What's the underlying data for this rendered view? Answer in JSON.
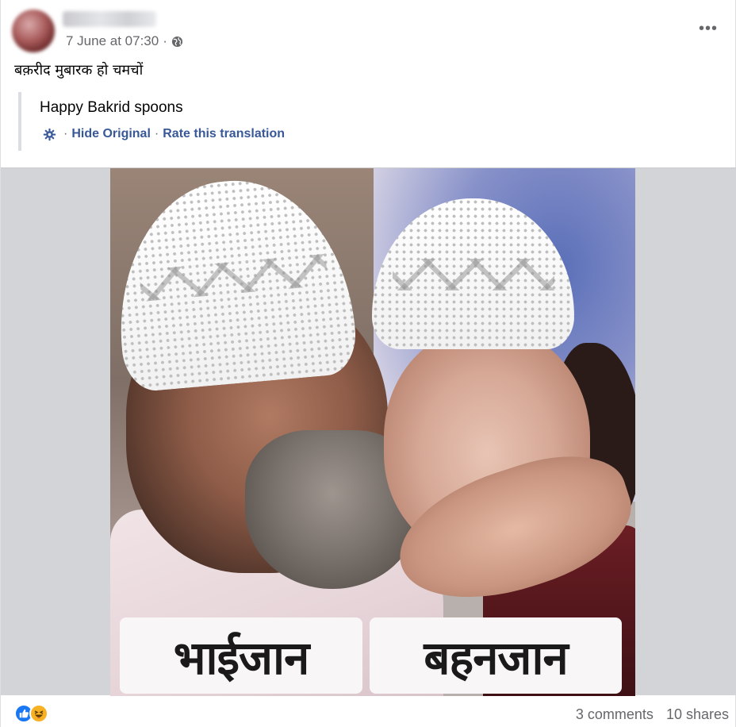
{
  "post": {
    "timestamp": "7 June at 07:30",
    "separator": "·",
    "privacy_icon": "globe-icon",
    "more_label": "•••",
    "text": "बक़रीद मुबारक हो चमचों"
  },
  "translation": {
    "translated_text": "Happy Bakrid spoons",
    "settings_icon": "gear-icon",
    "hide_original": "Hide Original",
    "rate": "Rate this translation",
    "sep1": "·",
    "sep2": "·"
  },
  "image": {
    "caption_left": "भाईजान",
    "caption_right": "बहनजान"
  },
  "footer": {
    "reactions": [
      "like-icon",
      "haha-icon"
    ],
    "comments": "3 comments",
    "shares": "10 shares"
  },
  "colors": {
    "link": "#385898",
    "muted": "#65676b",
    "like_blue": "#1877f2",
    "haha_yellow": "#f7b125"
  }
}
